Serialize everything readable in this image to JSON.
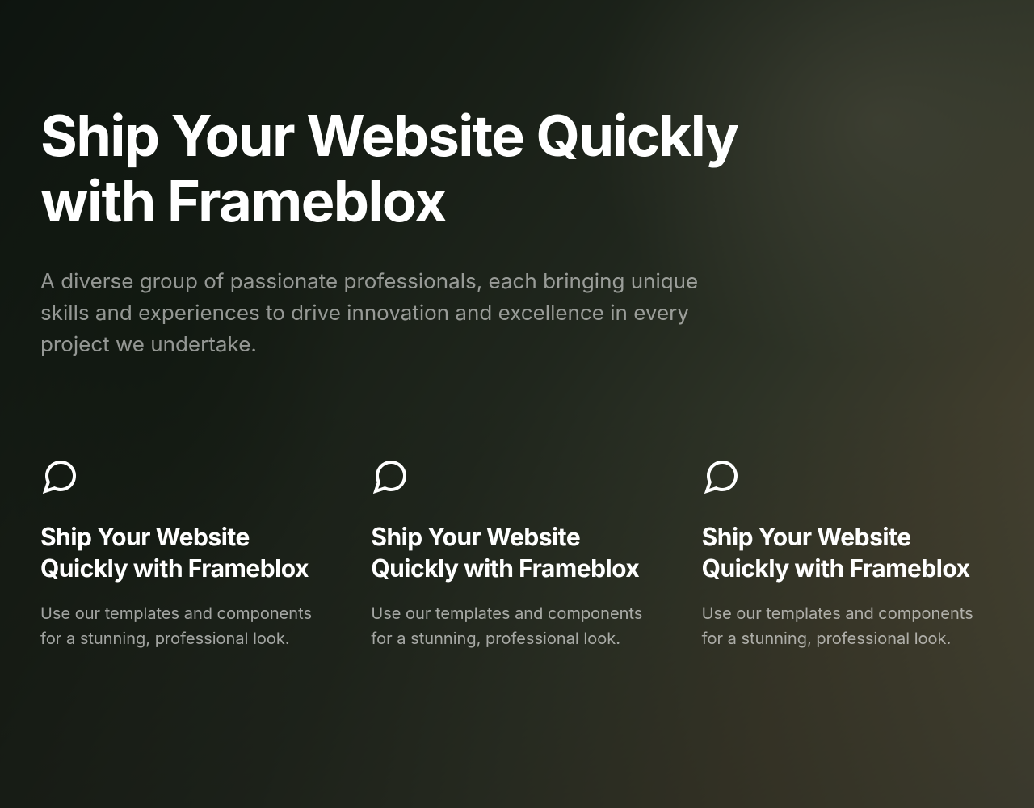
{
  "hero": {
    "title": "Ship Your Website Quickly with Frameblox",
    "subtitle": "A diverse group of passionate professionals, each bringing unique skills and experiences to drive innovation and excellence in every project we undertake."
  },
  "features": [
    {
      "icon": "chat-bubble-icon",
      "title": "Ship Your Website Quickly with Frameblox",
      "description": "Use our templates and components for a stunning, professional look."
    },
    {
      "icon": "chat-bubble-icon",
      "title": "Ship Your Website Quickly with Frameblox",
      "description": "Use our templates and components for a stunning, professional look."
    },
    {
      "icon": "chat-bubble-icon",
      "title": "Ship Your Website Quickly with Frameblox",
      "description": "Use our templates and components for a stunning, professional look."
    }
  ]
}
